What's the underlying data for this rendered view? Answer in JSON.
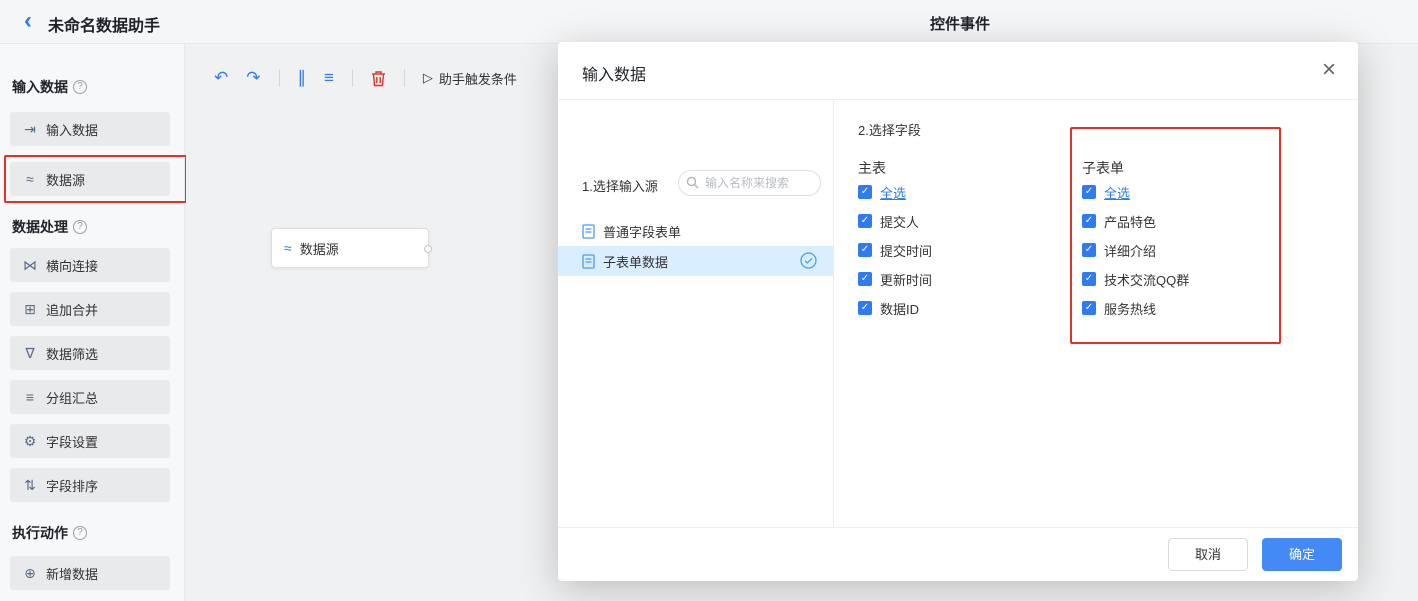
{
  "icons": {
    "back": "‹",
    "help": "?",
    "undo": "↶",
    "redo": "↷",
    "align_vertical": "∥",
    "align_horizontal": "≡",
    "play": "▷",
    "check": "✓",
    "close": "×"
  },
  "header": {
    "title": "未命名数据助手",
    "center_title": "控件事件"
  },
  "toolbar": {
    "trigger_label": "助手触发条件"
  },
  "canvas": {
    "node_label": "数据源"
  },
  "sidebar": {
    "sections": [
      {
        "label": "输入数据",
        "items": [
          {
            "label": "输入数据",
            "icon": "⇥"
          },
          {
            "label": "数据源",
            "icon": "≈",
            "annotated": true
          }
        ]
      },
      {
        "label": "数据处理",
        "items": [
          {
            "label": "横向连接",
            "icon": "⋈"
          },
          {
            "label": "追加合并",
            "icon": "⊞"
          },
          {
            "label": "数据筛选",
            "icon": "∇"
          },
          {
            "label": "分组汇总",
            "icon": "≡"
          },
          {
            "label": "字段设置",
            "icon": "⚙"
          },
          {
            "label": "字段排序",
            "icon": "⇅"
          }
        ]
      },
      {
        "label": "执行动作",
        "items": [
          {
            "label": "新增数据",
            "icon": "⊕"
          }
        ]
      }
    ]
  },
  "modal": {
    "title": "输入数据",
    "source_section": {
      "heading": "1.选择输入源",
      "search_placeholder": "输入名称来搜索",
      "items": [
        {
          "label": "普通字段表单",
          "selected": false
        },
        {
          "label": "子表单数据",
          "selected": true
        }
      ]
    },
    "fields_section": {
      "heading": "2.选择字段",
      "groups": [
        {
          "title": "主表",
          "select_all": "全选",
          "fields": [
            "提交人",
            "提交时间",
            "更新时间",
            "数据ID"
          ]
        },
        {
          "title": "子表单",
          "select_all": "全选",
          "fields": [
            "产品特色",
            "详细介绍",
            "技术交流QQ群",
            "服务热线"
          ],
          "annotated": true
        }
      ]
    },
    "footer": {
      "cancel": "取消",
      "confirm": "确定"
    }
  },
  "colors": {
    "accent": "#2f7bf5",
    "annotation": "#e0322b",
    "selected_row": "#d9eeff"
  }
}
